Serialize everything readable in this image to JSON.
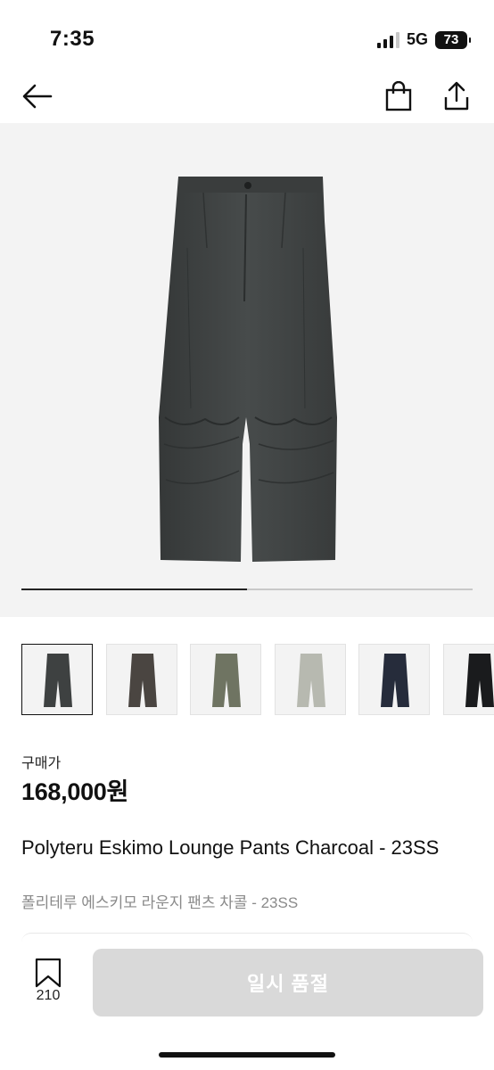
{
  "status_bar": {
    "time": "7:35",
    "network": "5G",
    "battery": "73"
  },
  "nav": {
    "back_icon": "arrow-left-icon",
    "bag_icon": "shopping-bag-icon",
    "share_icon": "share-icon"
  },
  "hero": {
    "image": "charcoal-wide-pants-photo",
    "carousel_progress": 0.5
  },
  "thumbnails": [
    {
      "color": "charcoal",
      "swatch": "#3e4141",
      "selected": true
    },
    {
      "color": "brown-gray",
      "swatch": "#4a4541",
      "selected": false
    },
    {
      "color": "khaki",
      "swatch": "#6f7462",
      "selected": false
    },
    {
      "color": "light-gray",
      "swatch": "#b7b9b0",
      "selected": false
    },
    {
      "color": "navy",
      "swatch": "#262c3b",
      "selected": false
    },
    {
      "color": "black",
      "swatch": "#1a1b1d",
      "selected": false
    }
  ],
  "product": {
    "price_label": "구매가",
    "price": "168,000원",
    "name_en": "Polyteru Eskimo Lounge Pants Charcoal - 23SS",
    "name_ko": "폴리테루 에스키모 라운지 팬츠 차콜 - 23SS"
  },
  "bottom_bar": {
    "bookmark_icon": "bookmark-icon",
    "bookmark_count": "210",
    "button_label": "일시 품절",
    "button_color": "#d9d9d9"
  }
}
